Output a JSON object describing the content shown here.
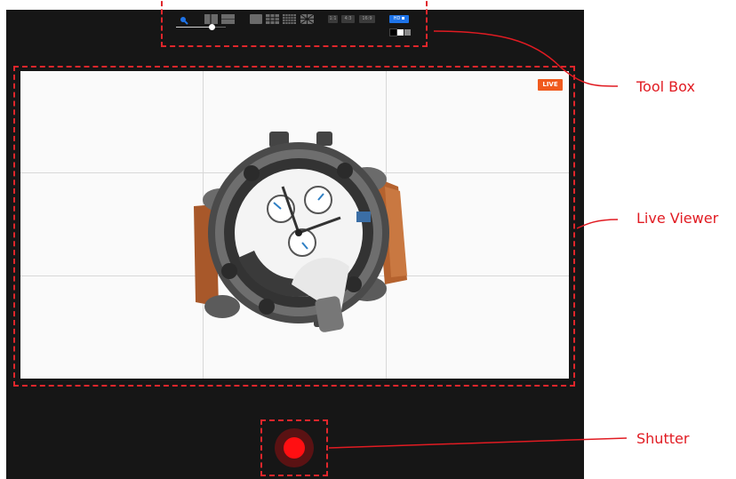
{
  "toolbar": {
    "ratio_buttons": [
      "1:1",
      "4:3",
      "16:9"
    ],
    "resolution_label": "HD",
    "zoom_level": 0.72
  },
  "viewer": {
    "badge": "LIVE",
    "subject": "wristwatch (chronograph with brown leather strap)"
  },
  "callouts": {
    "toolbox": "Tool Box",
    "live_viewer": "Live Viewer",
    "shutter": "Shutter"
  },
  "colors": {
    "annotation": "#e11b22",
    "accent": "#1e73e8",
    "live_badge": "#f05a1e",
    "shutter": "#ff0f12",
    "app_background": "#161616"
  }
}
